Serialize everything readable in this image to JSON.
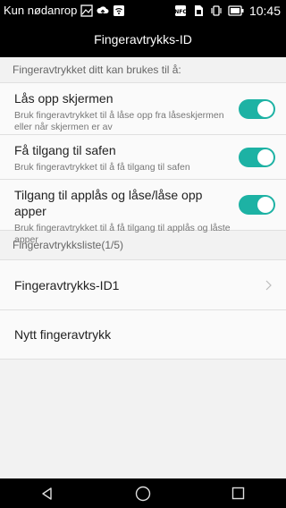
{
  "status_bar": {
    "carrier": "Kun nødanrop",
    "time": "10:45"
  },
  "title": "Fingeravtrykks-ID",
  "section_usage": {
    "header": "Fingeravtrykket ditt kan brukes til å:",
    "items": [
      {
        "title": "Lås opp skjermen",
        "subtitle": "Bruk fingeravtrykket til å låse opp fra låseskjermen eller når skjermen er av",
        "enabled": true
      },
      {
        "title": "Få tilgang til safen",
        "subtitle": "Bruk fingeravtrykket til å få tilgang til safen",
        "enabled": true
      },
      {
        "title": "Tilgang til applås og låse/låse opp apper",
        "subtitle": "Bruk fingeravtrykket til å få tilgang til applås og låste apper",
        "enabled": true
      }
    ]
  },
  "section_list": {
    "header": "Fingeravtrykksliste(1/5)",
    "fingerprint_1": "Fingeravtrykks-ID1",
    "new_fingerprint": "Nytt fingeravtrykk"
  },
  "colors": {
    "accent": "#1db2a4",
    "bars": "#000000"
  },
  "nav": {
    "icons": [
      "back-icon",
      "home-icon",
      "recents-icon"
    ]
  }
}
